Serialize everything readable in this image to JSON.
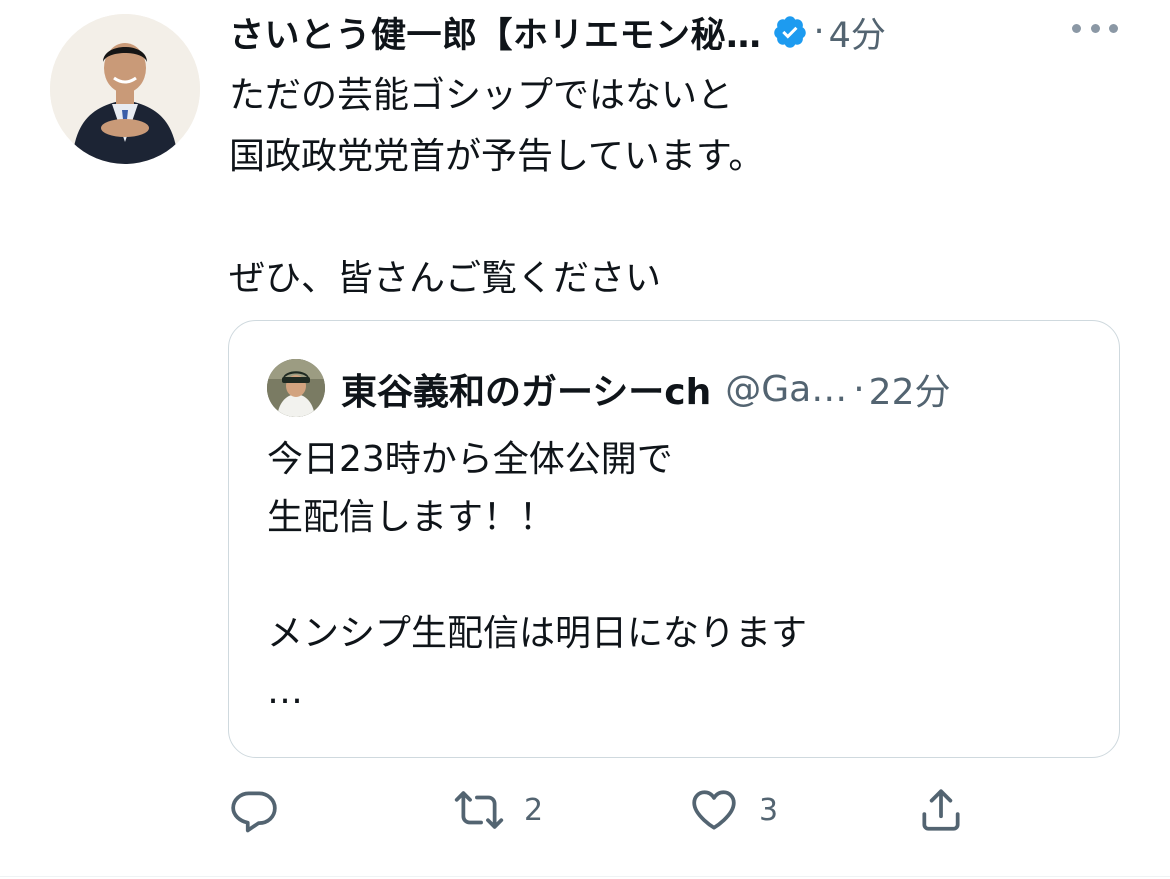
{
  "tweet": {
    "author_name": "さいとう健一郎【ホリエモン秘…",
    "separator": "·",
    "time": "4分",
    "text": "ただの芸能ゴシップではないと\n国政政党党首が予告しています。\n\nぜひ、皆さんご覧ください"
  },
  "quoted_tweet": {
    "author_name": "東谷義和のガーシーch",
    "handle": "@Ga…",
    "separator": "·",
    "time": "22分",
    "text": "今日23時から全体公開で\n生配信します！！\n\nメンシプ生配信は明日になります\n…"
  },
  "actions": {
    "reply_count": "",
    "retweet_count": "2",
    "like_count": "3"
  },
  "icons": {
    "verified": "verified-badge-icon",
    "more": "more-horizontal-icon",
    "reply": "reply-icon",
    "retweet": "retweet-icon",
    "like": "heart-icon",
    "share": "share-icon"
  },
  "colors": {
    "verified": "#1d9bf0",
    "secondary_text": "#536471",
    "border": "#cfd9de"
  }
}
